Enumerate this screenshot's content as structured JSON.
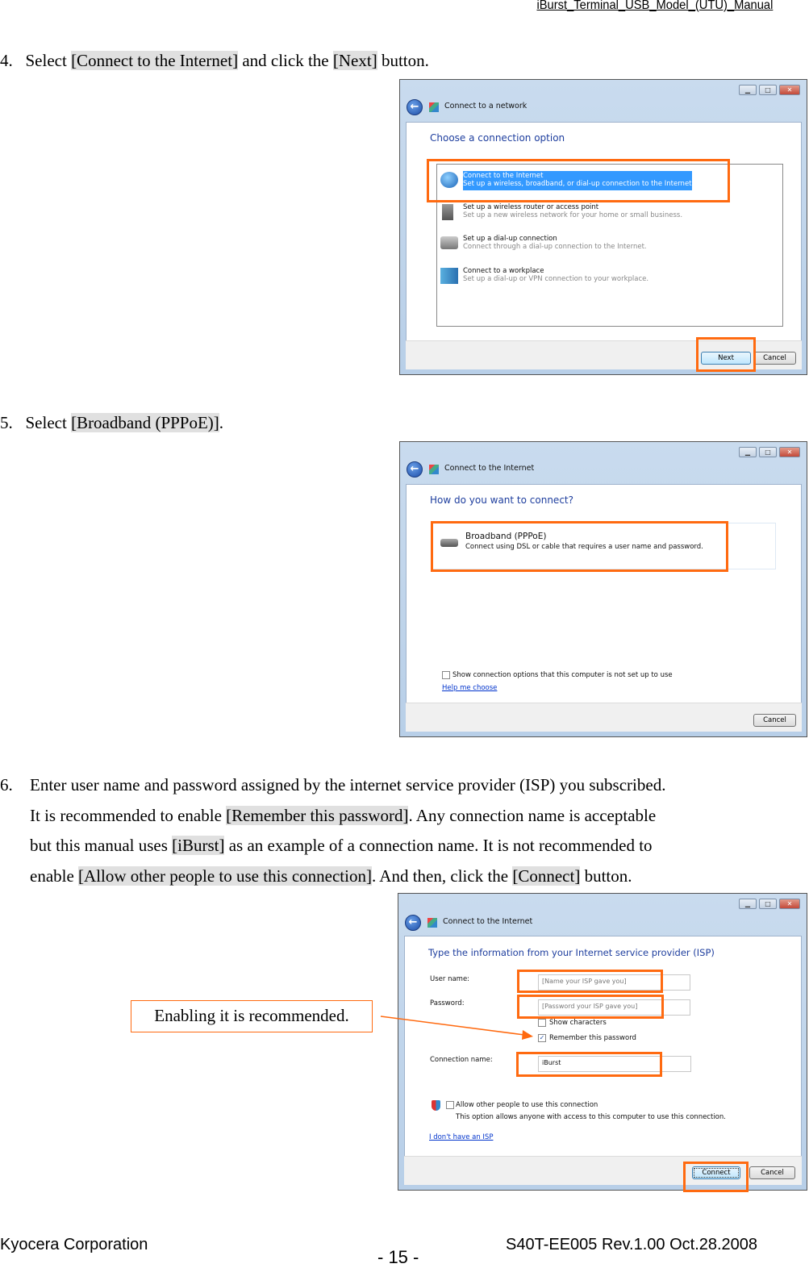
{
  "header": {
    "title": "iBurst_Terminal_USB_Model_(UTU)_Manual"
  },
  "step4": {
    "num": "4.",
    "pre": "Select ",
    "opt": "[Connect to the Internet]",
    "mid": " and click the ",
    "btn": "[Next]",
    "post": " button.",
    "dialog": {
      "title": "Connect to a network",
      "heading": "Choose a connection option",
      "options": [
        {
          "title": "Connect to the Internet",
          "desc": "Set up a wireless, broadband, or dial-up connection to the Internet.",
          "icon": "globe-icon",
          "selected": true
        },
        {
          "title": "Set up a wireless router or access point",
          "desc": "Set up a new wireless network for your home or small business.",
          "icon": "router-icon"
        },
        {
          "title": "Set up a dial-up connection",
          "desc": "Connect through a dial-up connection to the Internet.",
          "icon": "phone-icon"
        },
        {
          "title": "Connect to a workplace",
          "desc": "Set up a dial-up or VPN connection to your workplace.",
          "icon": "workplace-icon"
        }
      ],
      "next": "Next",
      "cancel": "Cancel"
    }
  },
  "step5": {
    "num": "5.",
    "pre": "Select ",
    "opt": "[Broadband (PPPoE)]",
    "post": ".",
    "dialog": {
      "title": "Connect to the Internet",
      "heading": "How do you want to connect?",
      "option": {
        "title": "Broadband (PPPoE)",
        "desc": "Connect using DSL or cable that requires a user name and password."
      },
      "checkbox": "Show connection options that this computer is not set up to use",
      "link": "Help me choose",
      "cancel": "Cancel"
    }
  },
  "step6": {
    "num": "6.",
    "l1": "Enter user name and password assigned by the internet service provider (ISP) you subscribed.",
    "l2a": "It is recommended to enable ",
    "l2b": "[Remember this password]",
    "l2c": ".   Any connection name is acceptable",
    "l3a": "but this manual uses ",
    "l3b": "[iBurst]",
    "l3c": " as an example of a connection name.   It is not recommended to",
    "l4a": "enable ",
    "l4b": "[Allow other people to use this connection]",
    "l4c": ".   And then, click the ",
    "l4d": "[Connect]",
    "l4e": " button.",
    "callout": "Enabling it is recommended.",
    "dialog": {
      "title": "Connect to the Internet",
      "heading": "Type the information from your Internet service provider (ISP)",
      "user_label": "User name:",
      "user_placeholder": "[Name your ISP gave you]",
      "pass_label": "Password:",
      "pass_placeholder": "[Password your ISP gave you]",
      "show_chars": "Show characters",
      "show_chars_checked": false,
      "remember": "Remember this password",
      "remember_checked": true,
      "conn_label": "Connection name:",
      "conn_value": "iBurst",
      "allow": "Allow other people to use this connection",
      "allow_checked": false,
      "allow_desc": "This option allows anyone with access to this computer to use this connection.",
      "link": "I don't have an ISP",
      "connect": "Connect",
      "cancel": "Cancel"
    }
  },
  "footer": {
    "company": "Kyocera Corporation",
    "page": "- 15 -",
    "doc": "S40T-EE005 Rev.1.00 Oct.28.2008"
  },
  "colors": {
    "highlight_box": "#ff6a10",
    "dialog_heading": "#1e3e9e",
    "selection": "#3399ff"
  }
}
